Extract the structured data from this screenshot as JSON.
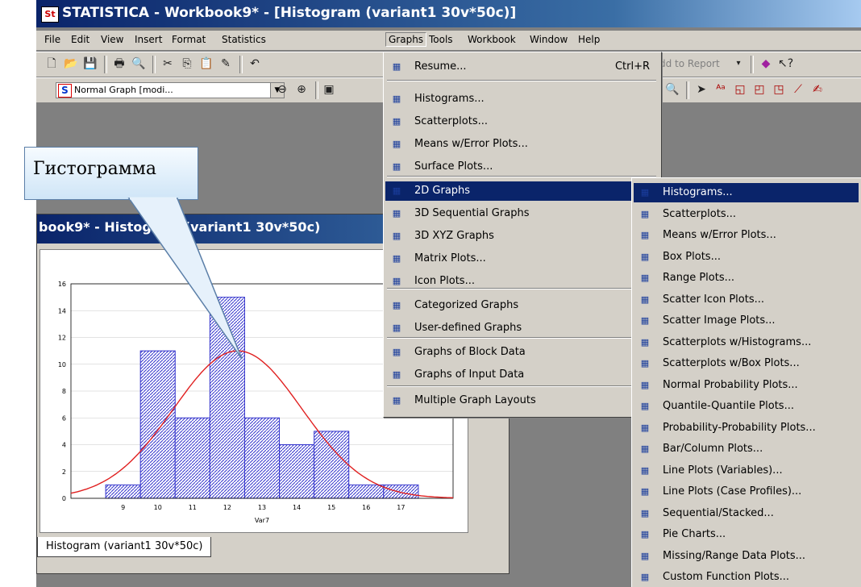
{
  "window": {
    "title": "STATISTICA - Workbook9* - [Histogram (variant1 30v*50c)]",
    "app_icon": "statistica-icon"
  },
  "menubar": [
    "File",
    "Edit",
    "View",
    "Insert",
    "Format",
    "Statistics",
    "Graphs",
    "Tools",
    "Workbook",
    "Window",
    "Help"
  ],
  "toolbar1": {
    "add_to_report": "Add to Report"
  },
  "toolbar2": {
    "graph_combo": "Normal Graph [modi...",
    "graph_badge": "S"
  },
  "graphs_menu": {
    "items": [
      {
        "label": "Resume...",
        "shortcut": "Ctrl+R",
        "icon": "resume-arrow-icon"
      },
      {
        "label": "Histograms...",
        "icon": "histogram-icon"
      },
      {
        "label": "Scatterplots...",
        "icon": "scatterplot-icon"
      },
      {
        "label": "Means w/Error Plots...",
        "icon": "means-error-icon"
      },
      {
        "label": "Surface Plots...",
        "icon": "surface-icon"
      },
      {
        "label": "2D Graphs",
        "icon": "graph-2d-icon",
        "submenu": true,
        "highlighted": true
      },
      {
        "label": "3D Sequential Graphs",
        "icon": "graph-3d-sequential-icon",
        "submenu": true
      },
      {
        "label": "3D XYZ Graphs",
        "icon": "graph-3d-xyz-icon",
        "submenu": true
      },
      {
        "label": "Matrix Plots...",
        "icon": "matrix-icon"
      },
      {
        "label": "Icon Plots...",
        "icon": "icon-plot-icon"
      },
      {
        "label": "Categorized Graphs",
        "icon": "categorized-icon",
        "submenu": true
      },
      {
        "label": "User-defined Graphs",
        "icon": "user-defined-icon",
        "submenu": true
      },
      {
        "label": "Graphs of Block Data",
        "icon": "block-data-icon",
        "submenu": true
      },
      {
        "label": "Graphs of Input Data",
        "icon": "input-data-icon",
        "submenu": true
      },
      {
        "label": "Multiple Graph Layouts",
        "icon": "layouts-icon",
        "submenu": true
      }
    ]
  },
  "submenu_2d": {
    "items": [
      {
        "label": "Histograms...",
        "icon": "histogram-icon",
        "highlighted": true
      },
      {
        "label": "Scatterplots...",
        "icon": "scatterplot-icon"
      },
      {
        "label": "Means w/Error Plots...",
        "icon": "means-error-icon"
      },
      {
        "label": "Box Plots...",
        "icon": "box-plot-icon"
      },
      {
        "label": "Range Plots...",
        "icon": "range-plot-icon"
      },
      {
        "label": "Scatter Icon Plots...",
        "icon": "scatter-icon-plot-icon"
      },
      {
        "label": "Scatter Image Plots...",
        "icon": "scatter-image-icon"
      },
      {
        "label": "Scatterplots w/Histograms...",
        "icon": "scatter-histogram-icon"
      },
      {
        "label": "Scatterplots w/Box Plots...",
        "icon": "scatter-box-icon"
      },
      {
        "label": "Normal Probability Plots...",
        "icon": "normal-probability-icon"
      },
      {
        "label": "Quantile-Quantile Plots...",
        "icon": "qq-plot-icon"
      },
      {
        "label": "Probability-Probability Plots...",
        "icon": "pp-plot-icon"
      },
      {
        "label": "Bar/Column Plots...",
        "icon": "bar-column-icon"
      },
      {
        "label": "Line Plots (Variables)...",
        "icon": "line-variables-icon"
      },
      {
        "label": "Line Plots (Case Profiles)...",
        "icon": "line-case-icon"
      },
      {
        "label": "Sequential/Stacked...",
        "icon": "stacked-icon"
      },
      {
        "label": "Pie Charts...",
        "icon": "pie-icon"
      },
      {
        "label": "Missing/Range Data Plots...",
        "icon": "missing-data-icon"
      },
      {
        "label": "Custom Function Plots...",
        "icon": "custom-function-icon"
      }
    ]
  },
  "doc_window": {
    "title": "book9* - Histogram (variant1 30v*50c)",
    "tab_label": "Histogram (variant1 30v*50c)"
  },
  "callout": {
    "text": "Гистограмма"
  },
  "colors": {
    "accent": "#0a246a",
    "bars": "#3333cc",
    "curve": "#e02020"
  },
  "chart_data": {
    "type": "bar",
    "title": "",
    "xlabel": "Var7",
    "ylabel": "",
    "x_ticks": [
      9,
      10,
      11,
      12,
      13,
      14,
      15,
      16,
      17
    ],
    "y_ticks": [
      0,
      2,
      4,
      6,
      8,
      10,
      12,
      14,
      16
    ],
    "categories": [
      "8.5-9.5",
      "9.5-10.5",
      "10.5-11.5",
      "11.5-12.5",
      "12.5-13.5",
      "13.5-14.5",
      "14.5-15.5",
      "15.5-16.5",
      "16.5-17.5"
    ],
    "values": [
      1,
      11,
      6,
      15,
      6,
      4,
      5,
      1,
      1
    ],
    "normal_fit": {
      "mean": 12.3,
      "sd": 1.85,
      "peak": 11
    },
    "ylim": [
      0,
      16
    ],
    "xlim": [
      7.5,
      18.5
    ],
    "grid": true
  }
}
